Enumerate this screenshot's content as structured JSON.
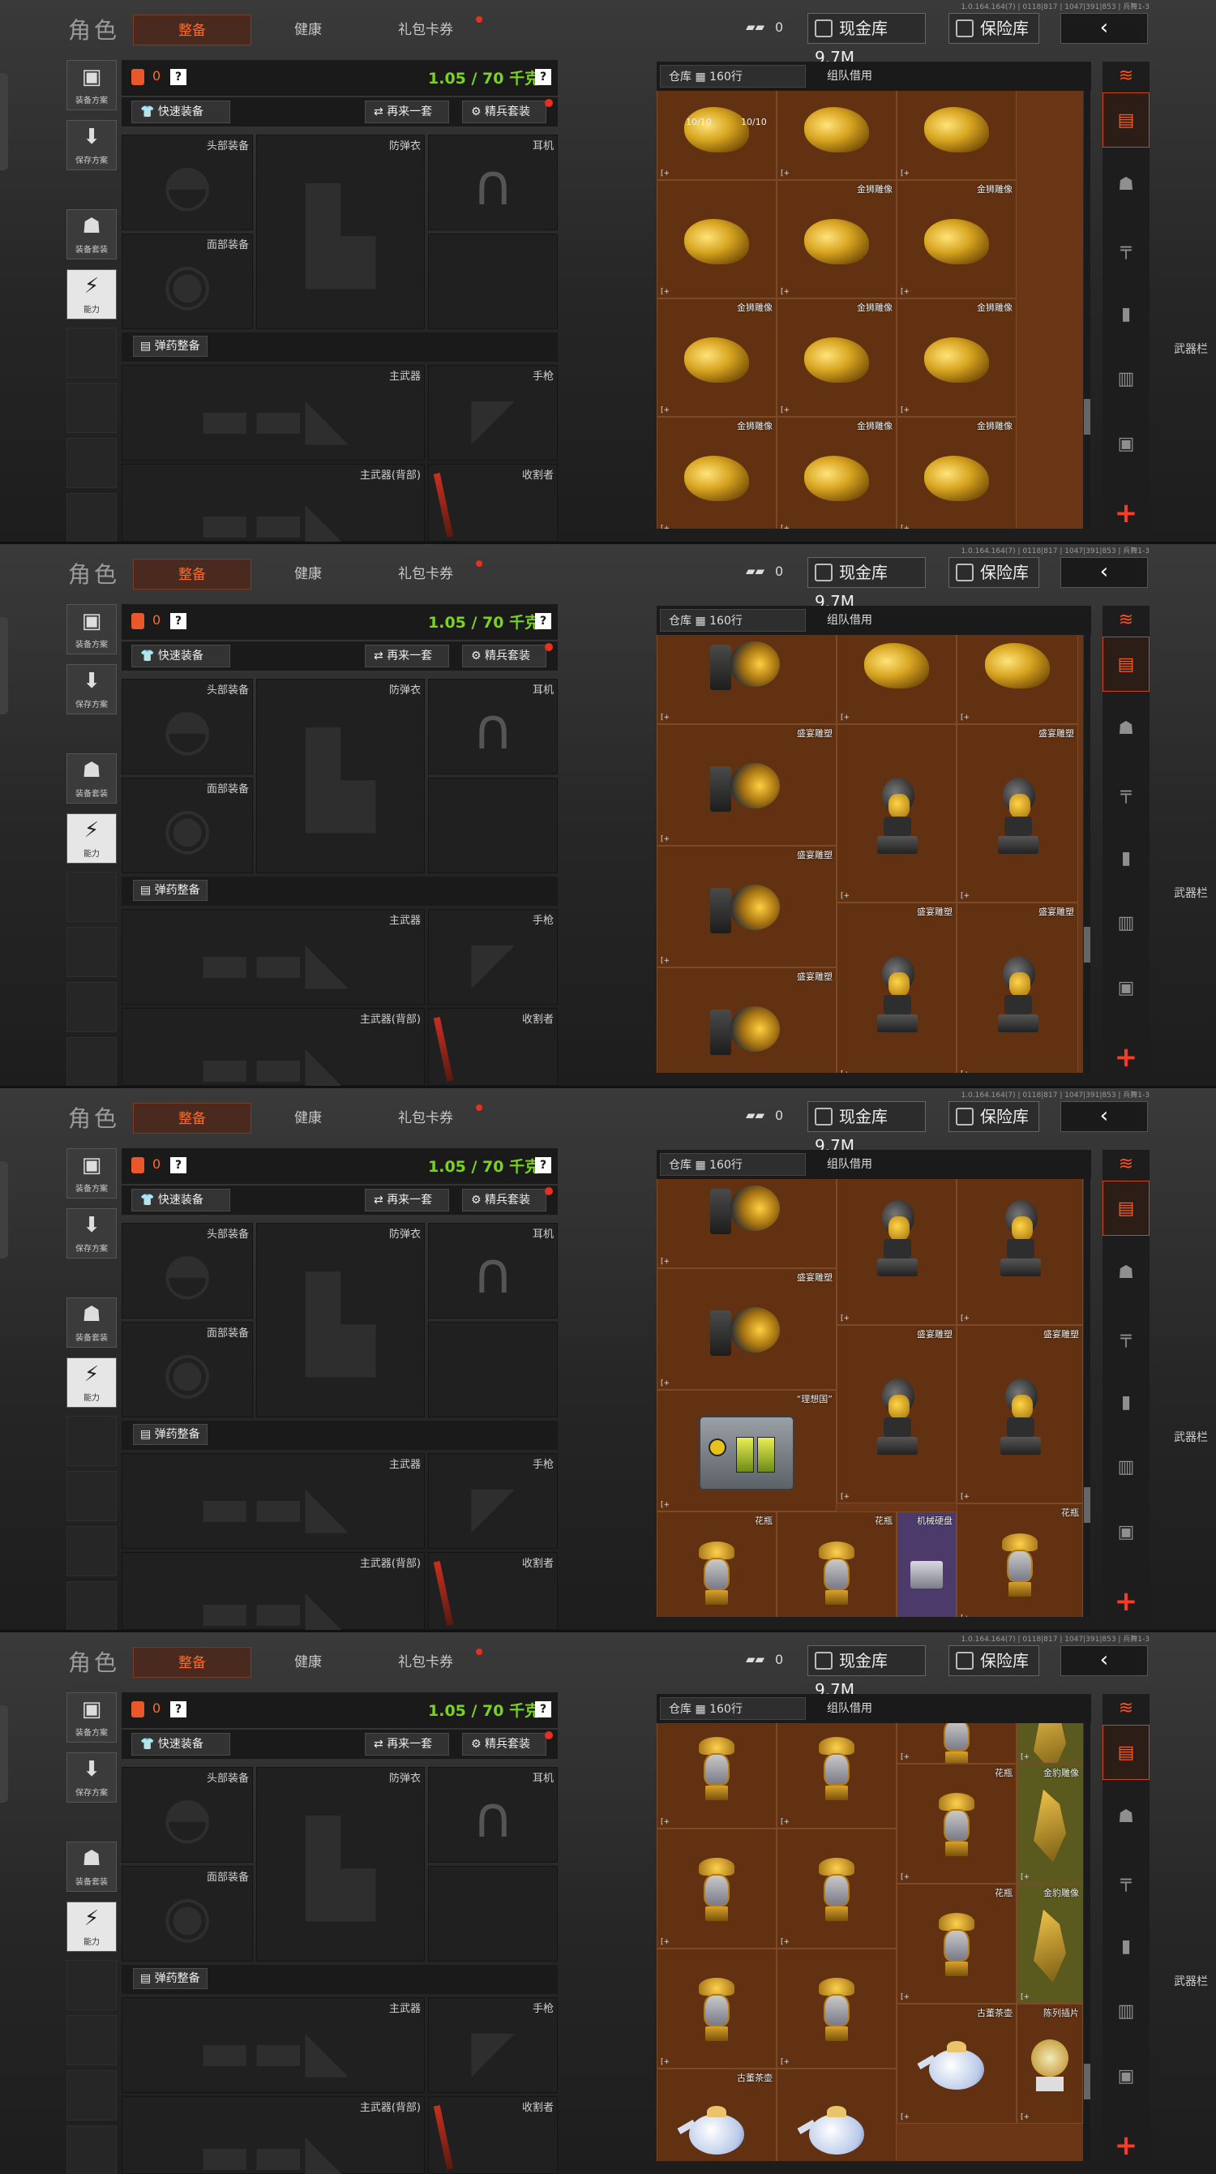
{
  "version": "1.0.164.164(7) | 0118|817 | 1047|391|853 | 兵舞1-3",
  "header": {
    "title": "角色",
    "tabs": [
      {
        "label": "整备",
        "active": true
      },
      {
        "label": "健康",
        "active": false
      },
      {
        "label": "礼包卡券",
        "active": false
      }
    ],
    "cash_count": "0",
    "cash_vault": "现金库 9.7M",
    "safe_box": "保险库",
    "back": "‹"
  },
  "side": {
    "save_plan": "装备方案",
    "save": "保存方案",
    "gear_pack": "装备套装",
    "ability": "能力"
  },
  "loadout": {
    "bag_count": "0",
    "help": "?",
    "weight": "1.05 / 70 千克",
    "quick_equip": "快速装备",
    "again": "再来一套",
    "elite_kit": "精兵套装",
    "slots": {
      "head": "头部装备",
      "armor": "防弹衣",
      "ear": "耳机",
      "face": "面部装备",
      "primary": "主武器",
      "pistol": "手枪",
      "primary_back": "主武器(背部)",
      "reaper": "收割者"
    },
    "ammo": "弹药整备",
    "weapon_bar": "武器栏"
  },
  "warehouse": {
    "tab_storage": "仓库",
    "rows": "160行",
    "tab_team": "组队借用"
  },
  "items": {
    "lion": "金狮雕像",
    "bust": "盛宴雕塑",
    "crate": "“理想国”",
    "disk": "机械硬盘",
    "vase": "花瓶",
    "teapot": "古董茶壶",
    "leopard": "金豹雕像",
    "plaque": "陈列插片",
    "count": "10/10"
  }
}
